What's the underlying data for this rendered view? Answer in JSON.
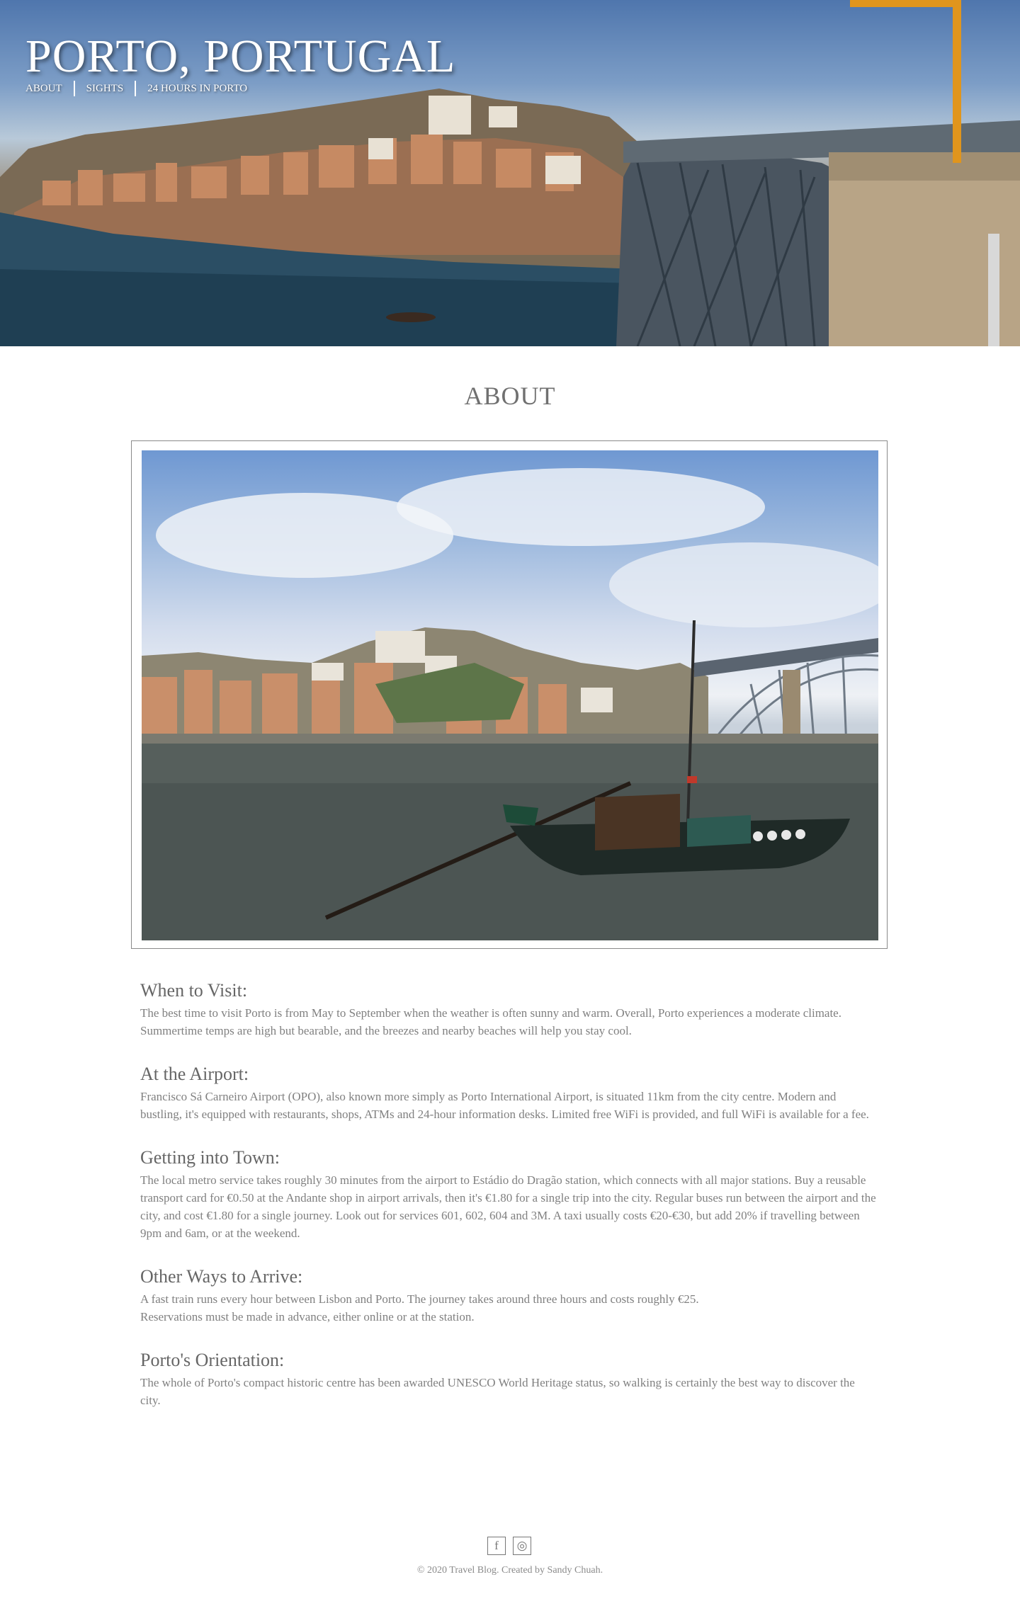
{
  "header": {
    "title": "PORTO, PORTUGAL",
    "nav": [
      "ABOUT",
      "SIGHTS",
      "24 HOURS IN PORTO"
    ]
  },
  "about": {
    "heading": "ABOUT",
    "sections": [
      {
        "title": "When to Visit:",
        "body": "The best time to visit Porto is from May to September when the weather is often sunny and warm. Overall, Porto experiences a moderate climate. Summertime temps are high but bearable, and the breezes and nearby beaches will help you stay cool."
      },
      {
        "title": "At the Airport:",
        "body": "Francisco Sá Carneiro Airport (OPO), also known more simply as Porto International Airport, is situated 11km from the city centre. Modern and bustling, it's equipped with restaurants, shops, ATMs and 24-hour information desks. Limited free WiFi is provided, and full WiFi is available for a fee."
      },
      {
        "title": "Getting into Town:",
        "body": "The local metro service takes roughly 30 minutes from the airport to Estádio do Dragão station, which connects with all major stations. Buy a reusable transport card for €0.50 at the Andante shop in airport arrivals, then it's €1.80 for a single trip into the city. Regular buses run between the airport and the city, and cost €1.80 for a single journey. Look out for services 601, 602, 604 and 3M. A taxi usually costs €20-€30, but add 20% if travelling between 9pm and 6am, or at the weekend."
      },
      {
        "title": "Other Ways to Arrive:",
        "body": "A fast train runs every hour between Lisbon and Porto. The journey takes around three hours and costs roughly €25. Reservations must be made in advance, either online or at the station."
      },
      {
        "title": "Porto's Orientation:",
        "body": "The whole of Porto's compact historic centre has been awarded UNESCO World Heritage status, so walking is certainly the best way to discover the city."
      }
    ]
  },
  "footer": {
    "social": [
      "facebook-icon",
      "instagram-icon"
    ],
    "facebook_glyph": "f",
    "instagram_glyph": "◎",
    "copyright": "© 2020 Travel Blog.  Created by Sandy Chuah."
  }
}
